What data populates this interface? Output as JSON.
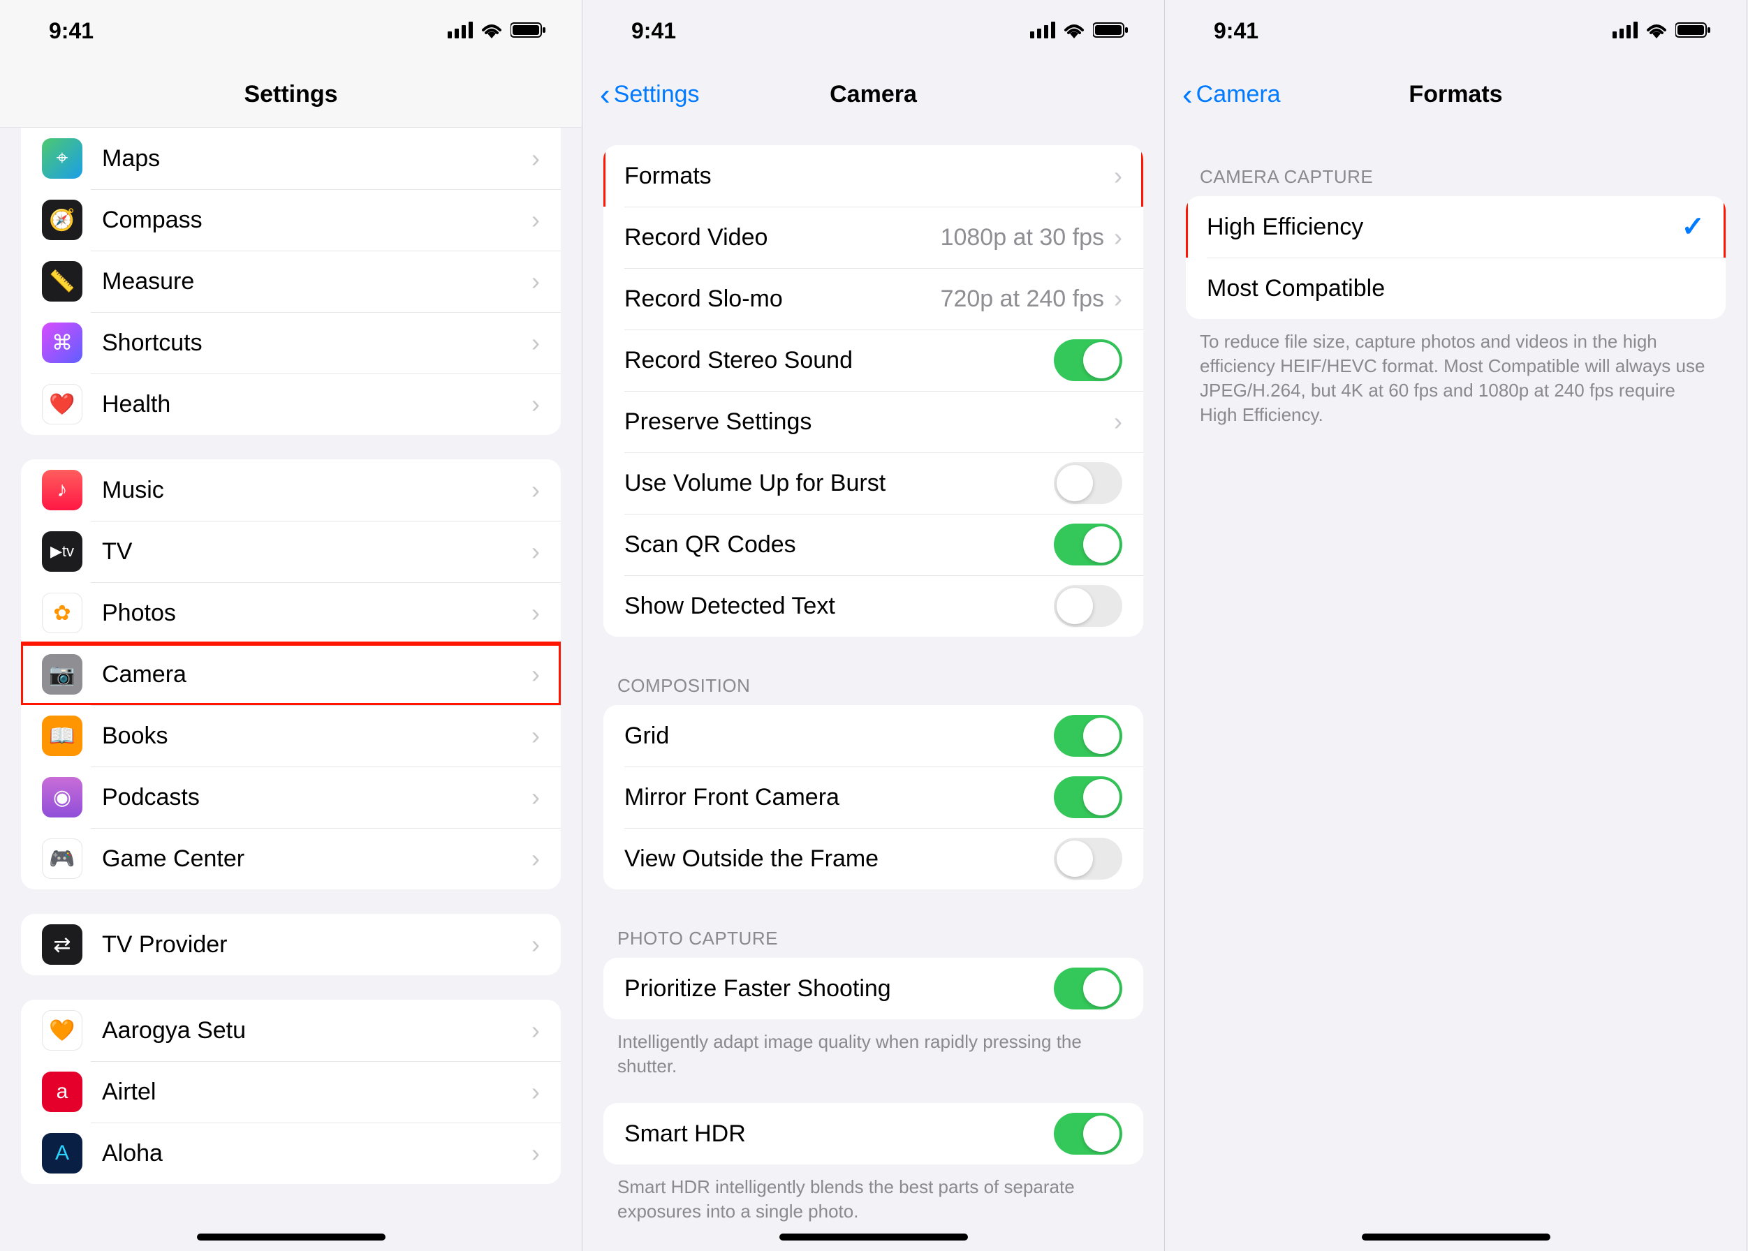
{
  "status": {
    "time": "9:41"
  },
  "phone1": {
    "title": "Settings",
    "groups": [
      {
        "type": "top",
        "rows": [
          {
            "icon": "maps-icon",
            "bg": "linear-gradient(135deg,#4ec96f,#1a9ee8)",
            "label": "Maps",
            "glyph": "⌖"
          },
          {
            "icon": "compass-icon",
            "bg": "#1c1c1e",
            "label": "Compass",
            "glyph": "🧭"
          },
          {
            "icon": "measure-icon",
            "bg": "#1c1c1e",
            "label": "Measure",
            "glyph": "📏"
          },
          {
            "icon": "shortcuts-icon",
            "bg": "linear-gradient(135deg,#d94cff,#5f5fff)",
            "label": "Shortcuts",
            "glyph": "⌘"
          },
          {
            "icon": "health-icon",
            "bg": "#fff",
            "label": "Health",
            "glyph": "❤️",
            "fg": "#ff2d55",
            "border": true
          }
        ]
      },
      {
        "type": "group",
        "rows": [
          {
            "icon": "music-icon",
            "bg": "linear-gradient(180deg,#ff5e5e,#ff1744)",
            "label": "Music",
            "glyph": "♪"
          },
          {
            "icon": "tv-icon",
            "bg": "#1c1c1e",
            "label": "TV",
            "glyph": "tv",
            "fg": "#fff"
          },
          {
            "icon": "photos-icon",
            "bg": "#fff",
            "label": "Photos",
            "glyph": "✿",
            "fg": "#ff9500",
            "border": true
          },
          {
            "icon": "camera-icon",
            "bg": "#8e8e93",
            "label": "Camera",
            "glyph": "📷",
            "highlight": true
          },
          {
            "icon": "books-icon",
            "bg": "#ff9500",
            "label": "Books",
            "glyph": "📖"
          },
          {
            "icon": "podcasts-icon",
            "bg": "linear-gradient(180deg,#c86dd7,#904ed9)",
            "label": "Podcasts",
            "glyph": "◉"
          },
          {
            "icon": "gamecenter-icon",
            "bg": "#fff",
            "label": "Game Center",
            "glyph": "🎮",
            "border": true
          }
        ]
      },
      {
        "type": "group",
        "rows": [
          {
            "icon": "tvprovider-icon",
            "bg": "#1c1c1e",
            "label": "TV Provider",
            "glyph": "⇄"
          }
        ]
      },
      {
        "type": "group",
        "rows": [
          {
            "icon": "aarogya-icon",
            "bg": "#fff",
            "label": "Aarogya Setu",
            "glyph": "🧡",
            "border": true
          },
          {
            "icon": "airtel-icon",
            "bg": "#e4002b",
            "label": "Airtel",
            "glyph": "a",
            "fg": "#fff"
          },
          {
            "icon": "aloha-icon",
            "bg": "#0a1f44",
            "label": "Aloha",
            "glyph": "A",
            "fg": "#2ad4ff"
          }
        ]
      }
    ]
  },
  "phone2": {
    "back": "Settings",
    "title": "Camera",
    "sections": [
      {
        "rows": [
          {
            "label": "Formats",
            "kind": "disclosure",
            "highlight": true
          },
          {
            "label": "Record Video",
            "kind": "disclosure",
            "value": "1080p at 30 fps"
          },
          {
            "label": "Record Slo-mo",
            "kind": "disclosure",
            "value": "720p at 240 fps"
          },
          {
            "label": "Record Stereo Sound",
            "kind": "switch",
            "on": true
          },
          {
            "label": "Preserve Settings",
            "kind": "disclosure"
          },
          {
            "label": "Use Volume Up for Burst",
            "kind": "switch",
            "on": false
          },
          {
            "label": "Scan QR Codes",
            "kind": "switch",
            "on": true
          },
          {
            "label": "Show Detected Text",
            "kind": "switch",
            "on": false
          }
        ]
      },
      {
        "header": "COMPOSITION",
        "rows": [
          {
            "label": "Grid",
            "kind": "switch",
            "on": true
          },
          {
            "label": "Mirror Front Camera",
            "kind": "switch",
            "on": true
          },
          {
            "label": "View Outside the Frame",
            "kind": "switch",
            "on": false
          }
        ]
      },
      {
        "header": "PHOTO CAPTURE",
        "rows": [
          {
            "label": "Prioritize Faster Shooting",
            "kind": "switch",
            "on": true
          }
        ],
        "footer": "Intelligently adapt image quality when rapidly pressing the shutter."
      },
      {
        "rows": [
          {
            "label": "Smart HDR",
            "kind": "switch",
            "on": true
          }
        ],
        "footer": "Smart HDR intelligently blends the best parts of separate exposures into a single photo."
      }
    ]
  },
  "phone3": {
    "back": "Camera",
    "title": "Formats",
    "section_header": "CAMERA CAPTURE",
    "options": [
      {
        "label": "High Efficiency",
        "checked": true,
        "highlight": true
      },
      {
        "label": "Most Compatible",
        "checked": false
      }
    ],
    "footer": "To reduce file size, capture photos and videos in the high efficiency HEIF/HEVC format. Most Compatible will always use JPEG/H.264, but 4K at 60 fps and 1080p at 240 fps require High Efficiency."
  }
}
